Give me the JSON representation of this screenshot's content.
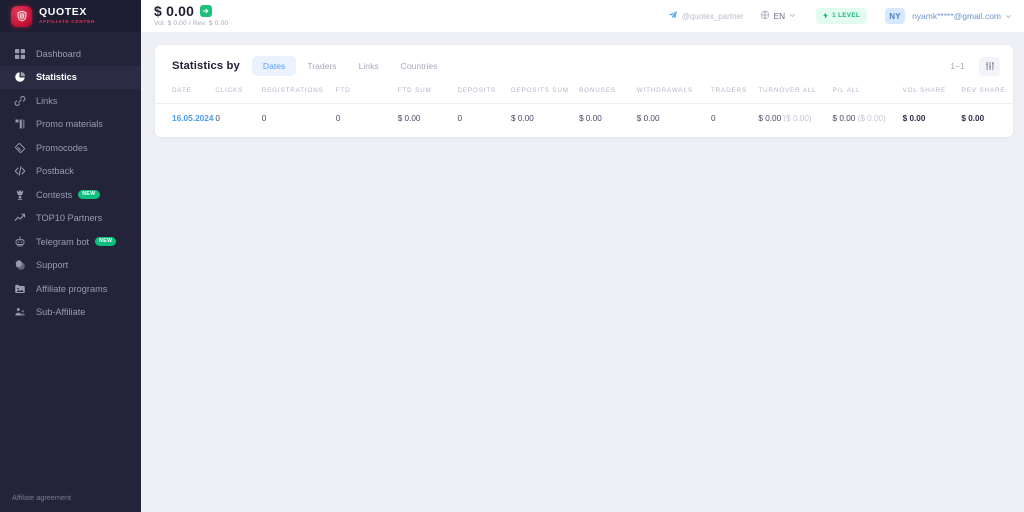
{
  "brand": {
    "title": "QUOTEX",
    "subtitle": "AFFILIATE CENTER",
    "logo_icon": "quotex-shield-icon"
  },
  "sidebar": {
    "items": [
      {
        "label": "Dashboard",
        "icon": "grid-icon",
        "active": false,
        "badge": ""
      },
      {
        "label": "Statistics",
        "icon": "pie-chart-icon",
        "active": true,
        "badge": ""
      },
      {
        "label": "Links",
        "icon": "link-icon",
        "active": false,
        "badge": ""
      },
      {
        "label": "Promo materials",
        "icon": "banner-icon",
        "active": false,
        "badge": ""
      },
      {
        "label": "Promocodes",
        "icon": "ticket-icon",
        "active": false,
        "badge": ""
      },
      {
        "label": "Postback",
        "icon": "code-icon",
        "active": false,
        "badge": ""
      },
      {
        "label": "Contests",
        "icon": "trophy-icon",
        "active": false,
        "badge": "NEW"
      },
      {
        "label": "TOP10 Partners",
        "icon": "trending-up-icon",
        "active": false,
        "badge": ""
      },
      {
        "label": "Telegram bot",
        "icon": "robot-icon",
        "active": false,
        "badge": "NEW"
      },
      {
        "label": "Support",
        "icon": "support-icon",
        "active": false,
        "badge": ""
      },
      {
        "label": "Affiliate programs",
        "icon": "folder-icon",
        "active": false,
        "badge": ""
      },
      {
        "label": "Sub-Affiliate",
        "icon": "share-users-icon",
        "active": false,
        "badge": ""
      }
    ],
    "footer_link": "Affilate agreement"
  },
  "topbar": {
    "balance": "$ 0.00",
    "balance_action_icon": "arrow-right-icon",
    "balance_sub": "Vol: $ 0.00 / Rev: $ 0.00",
    "telegram_handle": "@quotex_partner",
    "telegram_icon": "telegram-icon",
    "language": "EN",
    "language_icon": "globe-icon",
    "language_chevron_icon": "chevron-down-icon",
    "level_badge": "1 LEVEL",
    "level_icon": "lightning-icon",
    "avatar_initials": "NY",
    "account_email": "nyamk*****@gmail.com",
    "account_chevron_icon": "chevron-down-icon"
  },
  "card": {
    "title": "Statistics by",
    "tabs": [
      {
        "label": "Dates",
        "active": true
      },
      {
        "label": "Traders",
        "active": false
      },
      {
        "label": "Links",
        "active": false
      },
      {
        "label": "Countries",
        "active": false
      }
    ],
    "pagination": "1–1",
    "columns_button_icon": "columns-settings-icon"
  },
  "table": {
    "headers": [
      "DATE",
      "CLICKS",
      "REGISTRATIONS",
      "FTD",
      "FTD SUM",
      "DEPOSITS",
      "DEPOSITS SUM",
      "BONUSES",
      "WITHDRAWALS",
      "TRADERS",
      "TURNOVER ALL",
      "P/L ALL",
      "VOL SHARE",
      "REV SHARE"
    ],
    "rows": [
      {
        "date": "16.05.2024",
        "clicks": "0",
        "registrations": "0",
        "ftd": "0",
        "ftd_sum": "$ 0.00",
        "deposits": "0",
        "deposits_sum": "$ 0.00",
        "bonuses": "$ 0.00",
        "withdrawals": "$ 0.00",
        "traders": "0",
        "turnover_all": "$ 0.00",
        "turnover_all_sub": "($ 0.00)",
        "pl_all": "$ 0.00",
        "pl_all_sub": "($ 0.00)",
        "vol_share": "$ 0.00",
        "rev_share": "$ 0.00"
      }
    ]
  },
  "colors": {
    "sidebar_bg": "#23233a",
    "brand_red": "#e0335b",
    "accent_blue": "#57a0f5",
    "green": "#1ec07a",
    "page_bg": "#eef0f5"
  }
}
